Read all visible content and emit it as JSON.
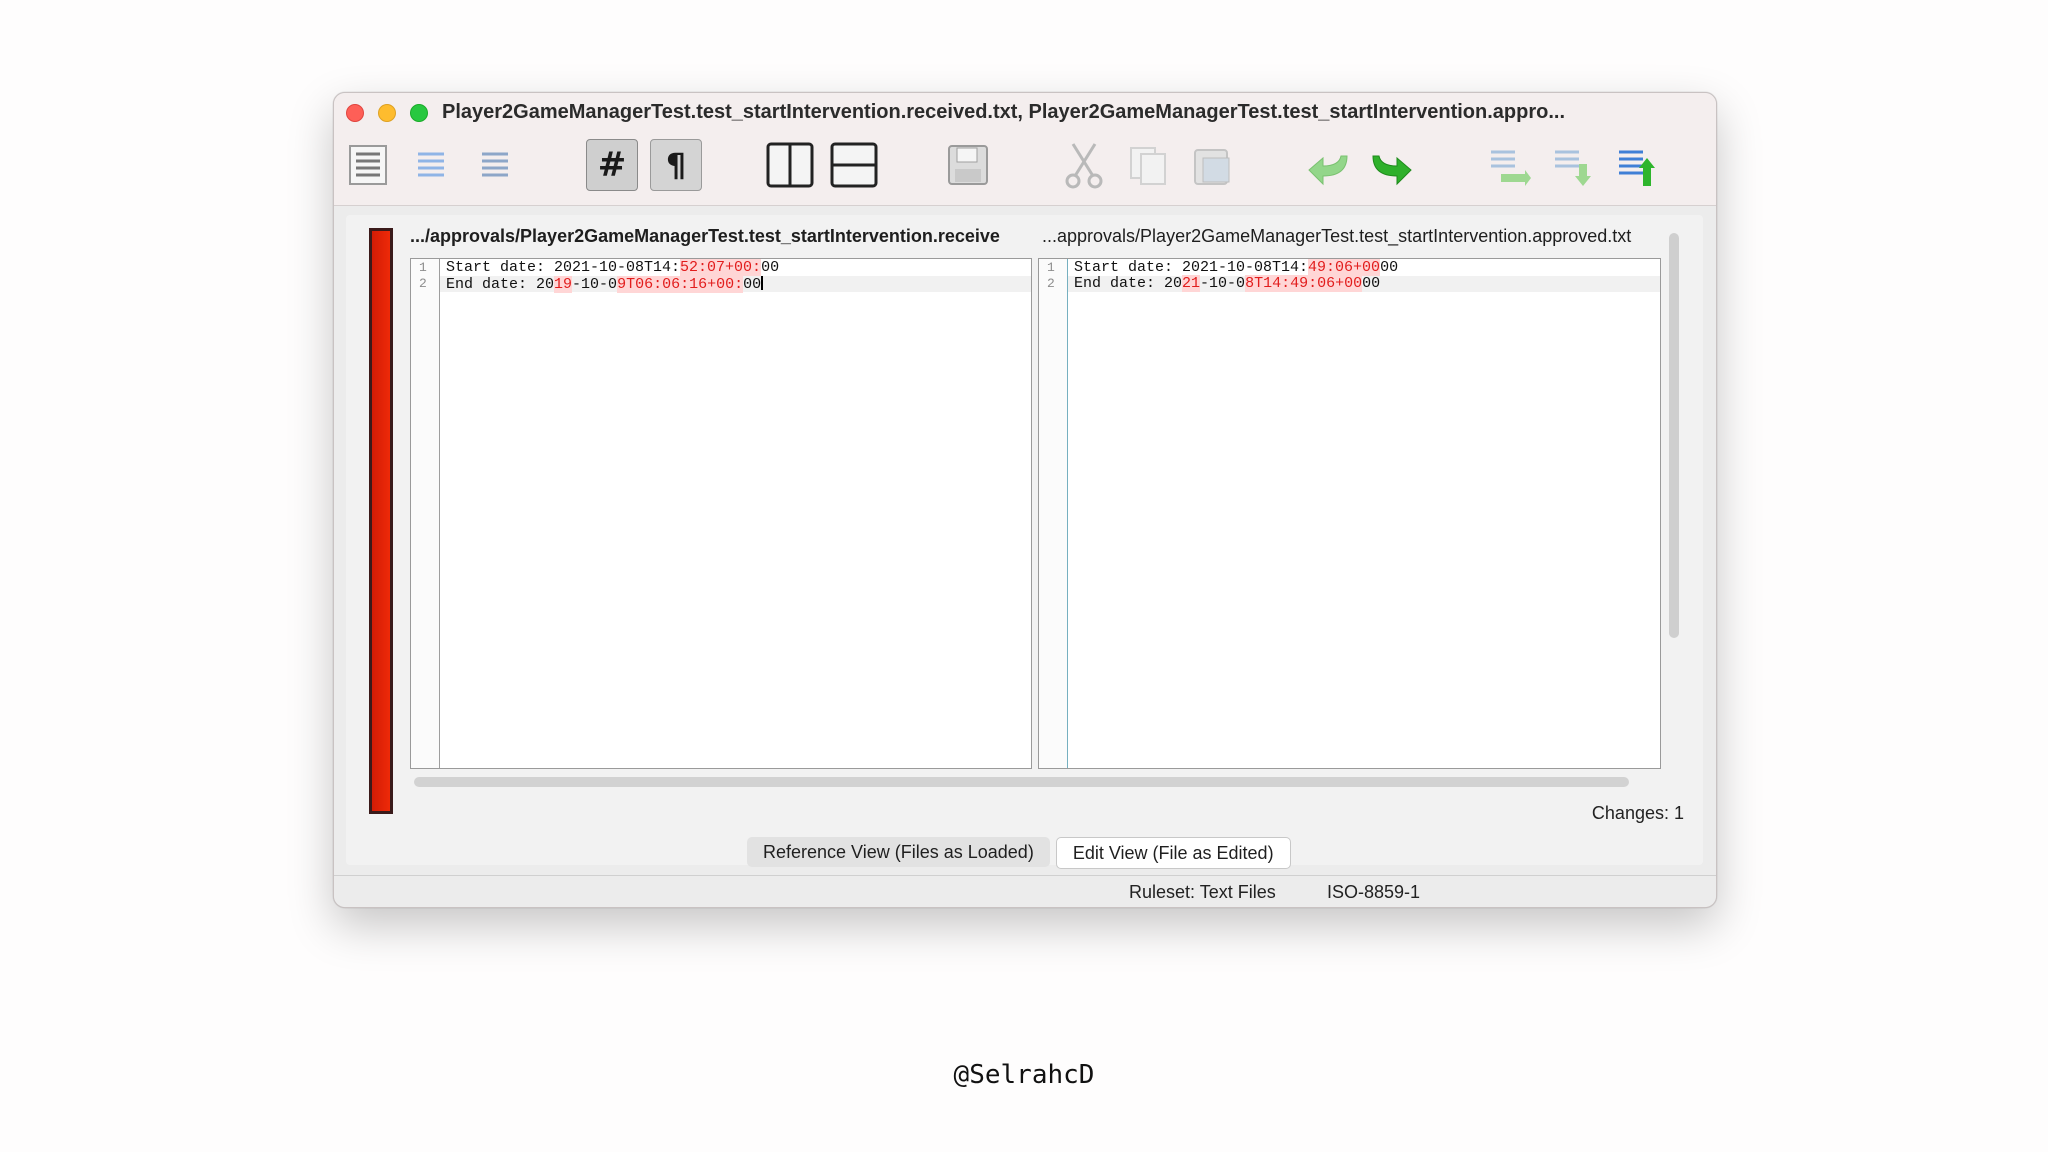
{
  "window": {
    "title": "Player2GameManagerTest.test_startIntervention.received.txt, Player2GameManagerTest.test_startIntervention.appro..."
  },
  "toolbar": {
    "buttons": [
      {
        "name": "document-icon"
      },
      {
        "name": "align-lines-icon"
      },
      {
        "name": "lines-icon"
      },
      {
        "name": "line-numbers-icon",
        "glyph": "#"
      },
      {
        "name": "pilcrow-icon",
        "glyph": "¶"
      },
      {
        "name": "side-by-side-icon"
      },
      {
        "name": "over-under-icon"
      },
      {
        "name": "save-icon"
      },
      {
        "name": "cut-icon"
      },
      {
        "name": "copy-icon"
      },
      {
        "name": "paste-icon"
      },
      {
        "name": "undo-icon"
      },
      {
        "name": "redo-icon"
      },
      {
        "name": "merge-down-icon"
      },
      {
        "name": "merge-right-icon"
      },
      {
        "name": "merge-up-icon"
      }
    ]
  },
  "left": {
    "path": ".../approvals/Player2GameManagerTest.test_startIntervention.receive",
    "lines": [
      {
        "num": "1",
        "parts": [
          "Start date: 2021-10-08T14:",
          "52:07+00:",
          "00"
        ]
      },
      {
        "num": "2",
        "parts": [
          "End date: 20",
          "19",
          "-10-0",
          "9T06:06:16+00:",
          "00"
        ]
      }
    ]
  },
  "right": {
    "path": "...approvals/Player2GameManagerTest.test_startIntervention.approved.txt",
    "lines": [
      {
        "num": "1",
        "parts": [
          "Start date: 2021-10-08T14:",
          "49:06+00",
          "00"
        ]
      },
      {
        "num": "2",
        "parts": [
          "End date: 20",
          "21",
          "-10-0",
          "8T14:49:06+00",
          "00"
        ]
      }
    ]
  },
  "status": {
    "changes": "Changes: 1",
    "ruleset": "Ruleset: Text Files",
    "encoding": "ISO-8859-1"
  },
  "tabs": {
    "reference": "Reference View (Files as Loaded)",
    "edit": "Edit View (File as Edited)"
  },
  "footer": "@SelrahcD",
  "colors": {
    "change_bar": "#e32408",
    "diff_highlight": "#e21d1d"
  }
}
